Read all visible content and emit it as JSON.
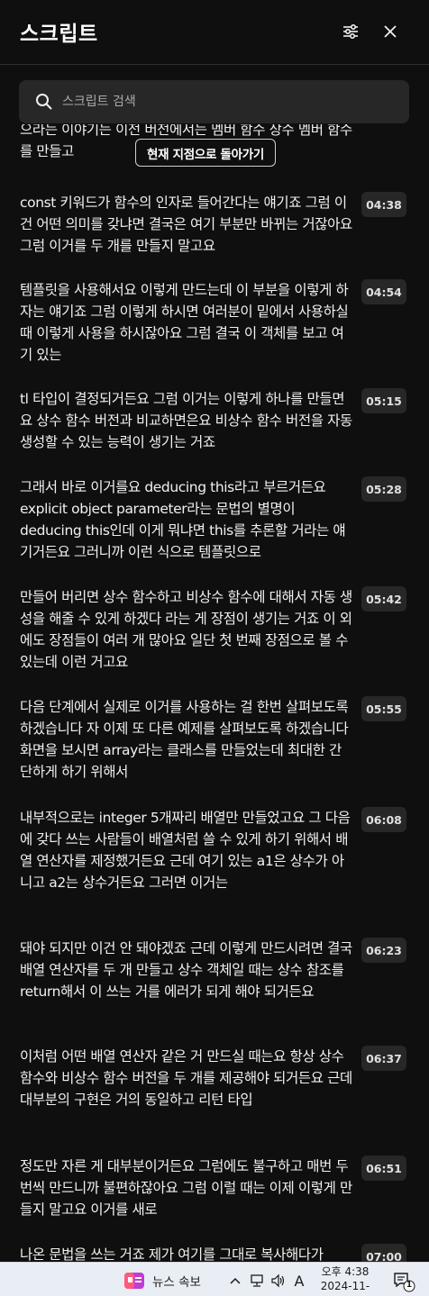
{
  "header": {
    "title": "스크립트",
    "filter_icon": "sliders-icon",
    "close_icon": "close-icon"
  },
  "search": {
    "placeholder": "스크립트 검색",
    "value": "",
    "icon": "search-icon"
  },
  "jump_button": {
    "label": "현재 지점으로 돌아가기"
  },
  "transcript": [
    {
      "time": "",
      "text": "으라는 이야기는 이전 버전에서는 멤버 함수 상수 멤버 함수를 만들고"
    },
    {
      "time": "04:38",
      "text": "const 키워드가 함수의 인자로 들어간다는 얘기죠 그럼 이건 어떤 의미를 갖냐면 결국은 여기 부분만 바뀌는 거잖아요 그럼 이거를 두 개를 만들지 말고요"
    },
    {
      "time": "04:54",
      "text": "템플릿을 사용해서요 이렇게 만드는데 이 부분을 이렇게 하자는 얘기죠 그럼 이렇게 하시면 여러분이 밑에서 사용하실 때 이렇게 사용을 하시잖아요 그럼 결국 이 객체를 보고 여기 있는"
    },
    {
      "time": "05:15",
      "text": "tl 타입이 결정되거든요 그럼 이거는 이렇게 하나를 만들면요 상수 함수 버전과 비교하면은요 비상수 함수 버전을 자동 생성할 수 있는 능력이 생기는 거죠"
    },
    {
      "time": "05:28",
      "text": "그래서 바로 이거를요 deducing this라고 부르거든요 explicit object parameter라는 문법의 별명이 deducing this인데 이게 뭐냐면 this를 추론할 거라는 얘기거든요 그러니까 이런 식으로 템플릿으로"
    },
    {
      "time": "05:42",
      "text": "만들어 버리면 상수 함수하고 비상수 함수에 대해서 자동 생성을 해줄 수 있게 하겠다 라는 게 장점이 생기는 거죠 이 외에도 장점들이 여러 개 많아요 일단 첫 번째 장점으로 볼 수 있는데 이런 거고요"
    },
    {
      "time": "05:55",
      "text": "다음 단계에서 실제로 이거를 사용하는 걸 한번 살펴보도록 하겠습니다 자 이제 또 다른 예제를 살펴보도록 하겠습니다 화면을 보시면 array라는 클래스를 만들었는데 최대한 간단하게 하기 위해서"
    },
    {
      "time": "06:08",
      "text": "내부적으로는 integer 5개짜리 배열만 만들었고요 그 다음에 갖다 쓰는 사람들이 배열처럼 쓸 수 있게 하기 위해서 배열 연산자를 제정했거든요 근데 여기 있는 a1은 상수가 아니고 a2는 상수거든요 그러면 이거는"
    },
    {
      "time": "06:23",
      "text": "돼야 되지만 이건 안 돼야겠죠 근데 이렇게 만드시려면 결국 배열 연산자를 두 개 만들고 상수 객체일 때는 상수 참조를 return해서 이 쓰는 거를 에러가 되게 해야 되거든요"
    },
    {
      "time": "06:37",
      "text": "이처럼 어떤 배열 연산자 같은 거 만드실 때는요 항상 상수 함수와 비상수 함수 버전을 두 개를 제공해야 되거든요 근데 대부분의 구현은 거의 동일하고 리턴 타입"
    },
    {
      "time": "06:51",
      "text": "정도만 자른 게 대부분이거든요 그럼에도 불구하고 매번 두 번씩 만드니까 불편하잖아요 그럼 이럴 때는 이제 이렇게 만들지 말고요 이거를 새로"
    },
    {
      "time": "07:00",
      "text": "나온 문법을 쓰는 거죠 제가 여기를 그대로 복사해다가"
    }
  ],
  "taskbar": {
    "news_label": "뉴스 속보",
    "ime": "A",
    "time": "오후 4:38",
    "date": "2024-11-10",
    "notification_count": "1"
  },
  "colors": {
    "background": "#0f0f0f",
    "timestamp_chip": "#272727",
    "search_bg": "#272727",
    "taskbar_bg": "#e9eef4"
  }
}
